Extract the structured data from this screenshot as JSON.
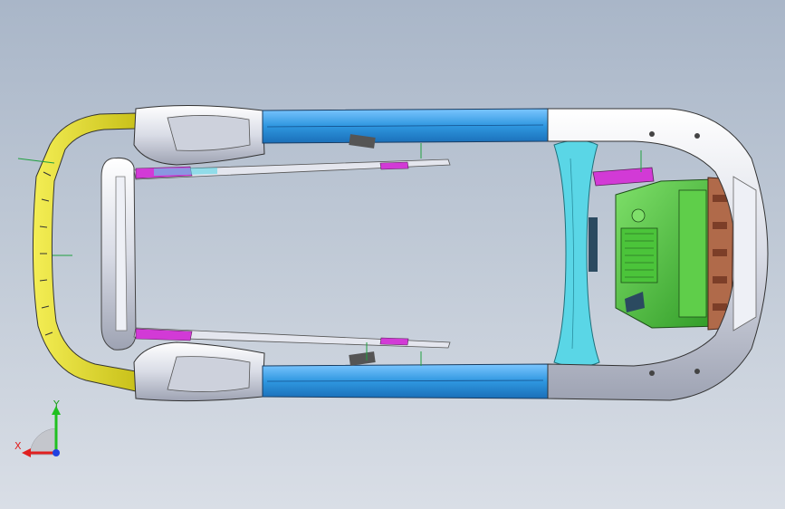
{
  "viewport": {
    "background_top": "#a9b6c8",
    "background_bottom": "#d9dee6"
  },
  "colors": {
    "yellow_bumper": "#e6df2a",
    "blue_rail": "#2f97e0",
    "cyan_crossmember": "#5ad6e6",
    "green_battery": "#4bc43a",
    "brown_bracket": "#b06a4a",
    "magenta_clip": "#d23ad6",
    "silver_part": "#dfe2ea"
  },
  "triad": {
    "x_label": "X",
    "y_label": "Y",
    "x_color": "#e02020",
    "y_color": "#20c020",
    "z_color": "#2040e0"
  }
}
